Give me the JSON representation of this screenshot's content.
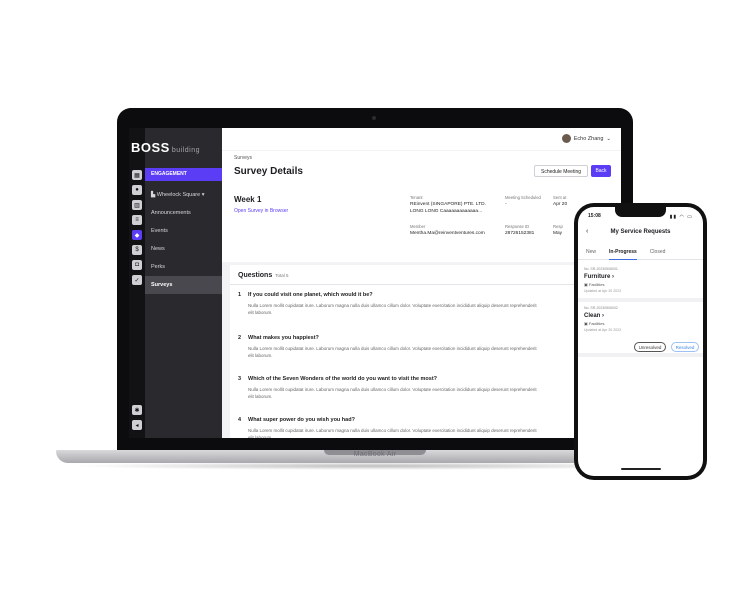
{
  "laptop": {
    "brand": "MacBook Air",
    "logo": {
      "main": "BOSS",
      "sub": "building"
    },
    "section_label": "ENGAGEMENT",
    "nav": [
      {
        "label": "Wheelock Square",
        "icon": "building-icon"
      },
      {
        "label": "Announcements"
      },
      {
        "label": "Events"
      },
      {
        "label": "News"
      },
      {
        "label": "Perks"
      },
      {
        "label": "Surveys"
      }
    ],
    "user_name": "Echo Zhang",
    "breadcrumb": "Surveys",
    "page_title": "Survey Details",
    "buttons": {
      "schedule": "Schedule Meeting",
      "back": "Back"
    },
    "survey": {
      "week": "Week 1",
      "open_link": "Open Survey in Browser",
      "tenant_label": "Tenant",
      "tenant_value_1": "REinvent (SINGAPORE) PTE. LTD.",
      "tenant_value_2": "LONG LONG Caaaaaaaaaaaaa...",
      "meeting_label": "Meeting Scheduled",
      "meeting_value": "-",
      "sent_label": "Sent at",
      "sent_value": "Apr 20",
      "member_label": "Member",
      "member_value": "Mentha.Ma@reinventventures.com",
      "response_label": "Response ID",
      "response_value": "28726152381",
      "resp_label": "Resp",
      "resp_value": "May"
    },
    "questions_title": "Questions",
    "questions_total": "Total 5",
    "questions": [
      {
        "num": "1",
        "text": "If you could visit one planet, which would it be?",
        "desc": "Nulla Lorem mollit cupidatat irure. Laborum magna nulla duis ullamco cillum dolor. Voluptate exercitation incididunt aliquip deserunt reprehenderit elit laborum.",
        "side": "Cr"
      },
      {
        "num": "2",
        "text": "What makes you happiest?",
        "desc": "Nulla Lorem mollit cupidatat irure. Laborum magna nulla duis ullamco cillum dolor. Voluptate exercitation incididunt aliquip deserunt reprehenderit elit laborum.",
        "side": "Cr"
      },
      {
        "num": "3",
        "text": "Which of the Seven Wonders of the world do you want to visit the most?",
        "desc": "Nulla Lorem mollit cupidatat irure. Laborum magna nulla duis ullamco cillum dolor. Voluptate exercitation incididunt aliquip deserunt reprehenderit elit laborum.",
        "side": "Cr"
      },
      {
        "num": "4",
        "text": "What super power do you wish you had?",
        "desc": "Nulla Lorem mollit cupidatat irure. Laborum magna nulla duis ullamco cillum dolor. Voluptate exercitation incididunt aliquip deserunt reprehenderit elit laborum.",
        "side": "Cr"
      }
    ]
  },
  "phone": {
    "time": "15:08",
    "title": "My Service Requests",
    "tabs": [
      "New",
      "In-Progress",
      "Closed"
    ],
    "active_tab": "In-Progress",
    "cards": [
      {
        "no": "No. SR-20230506001",
        "title": "Furniture",
        "sub": "Facilities",
        "date": "Updated at Apr 20 2023"
      },
      {
        "no": "No. SR-20230506002",
        "title": "Clean",
        "sub": "Facilities",
        "date": "Updated at Apr 20 2023"
      }
    ],
    "buttons": {
      "unresolved": "Unresolved",
      "resolved": "Resolved"
    }
  },
  "colors": {
    "accent": "#5b3df5",
    "phone_accent": "#3b87e8"
  }
}
